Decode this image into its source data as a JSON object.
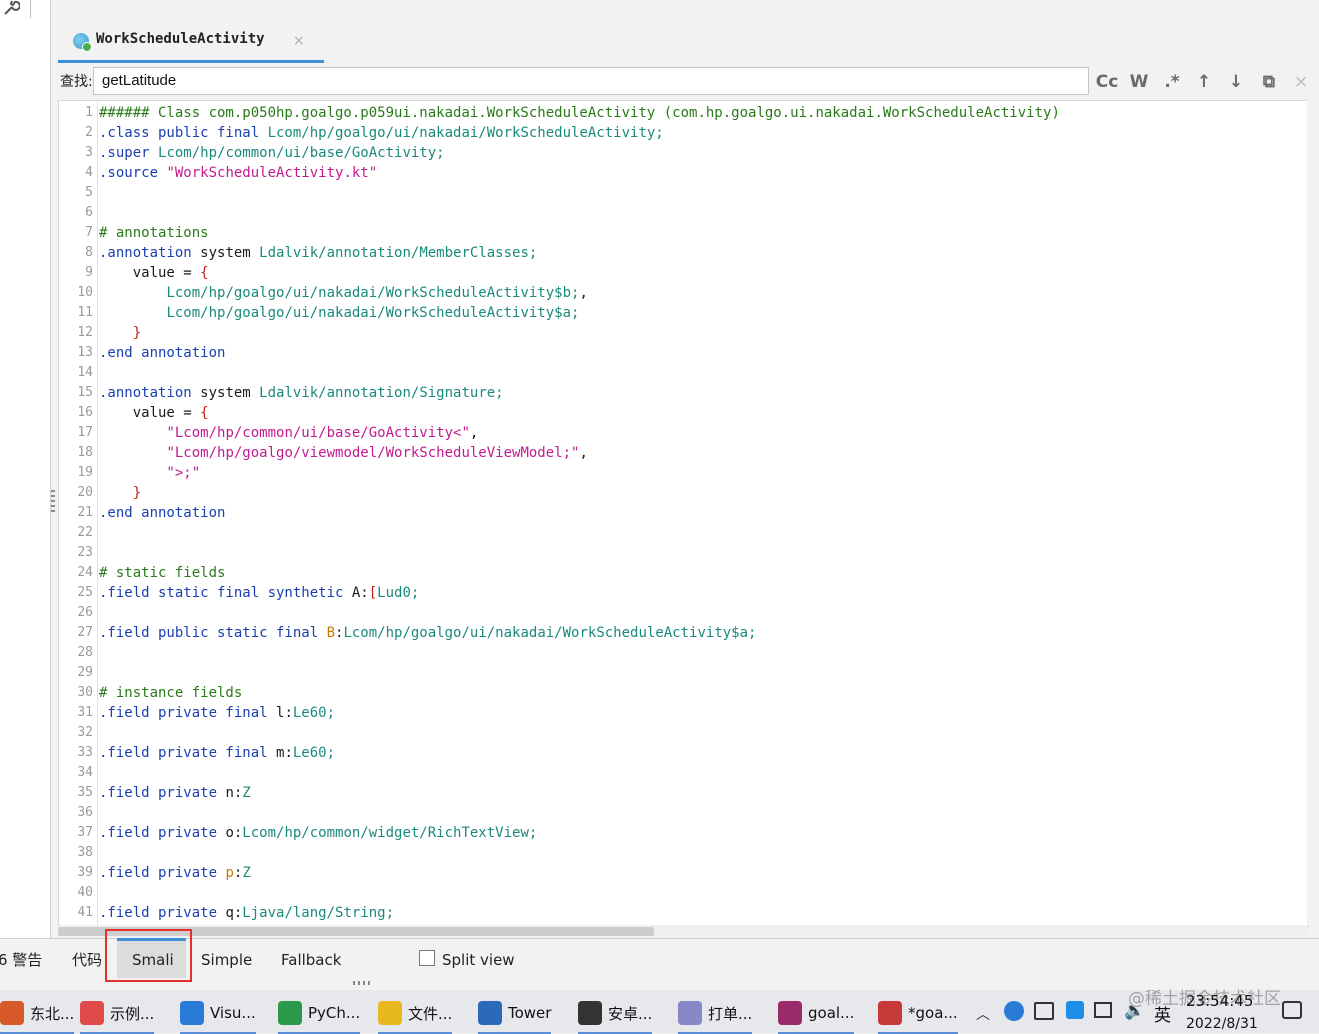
{
  "editor_tab": {
    "title": "WorkScheduleActivity",
    "close": "×"
  },
  "search": {
    "label": "查找:",
    "value": "getLatitude",
    "buttons": {
      "case": "Cc",
      "word": "W",
      "regex": ".*",
      "prev": "↑",
      "next": "↓",
      "find_all": "⧉",
      "close": "×"
    }
  },
  "code_lines": [
    [
      [
        "cm",
        "###### Class com.p050hp.goalgo.p059ui.nakadai.WorkScheduleActivity (com.hp.goalgo.ui.nakadai.WorkScheduleActivity)"
      ]
    ],
    [
      [
        "kw",
        ".class public final "
      ],
      [
        "ty",
        "Lcom/hp/goalgo/ui/nakadai/WorkScheduleActivity;"
      ]
    ],
    [
      [
        "kw",
        ".super "
      ],
      [
        "ty",
        "Lcom/hp/common/ui/base/GoActivity;"
      ]
    ],
    [
      [
        "kw",
        ".source "
      ],
      [
        "st",
        "\"WorkScheduleActivity.kt\""
      ]
    ],
    [],
    [],
    [
      [
        "cm",
        "# annotations"
      ]
    ],
    [
      [
        "kw",
        ".annotation "
      ],
      [
        "tx",
        "system "
      ],
      [
        "ty",
        "Ldalvik/annotation/MemberClasses;"
      ]
    ],
    [
      [
        "tx",
        "    value = "
      ],
      [
        "br",
        "{"
      ]
    ],
    [
      [
        "tx",
        "        "
      ],
      [
        "ty",
        "Lcom/hp/goalgo/ui/nakadai/WorkScheduleActivity$b;"
      ],
      [
        "tx",
        ","
      ]
    ],
    [
      [
        "tx",
        "        "
      ],
      [
        "ty",
        "Lcom/hp/goalgo/ui/nakadai/WorkScheduleActivity$a;"
      ]
    ],
    [
      [
        "tx",
        "    "
      ],
      [
        "br",
        "}"
      ]
    ],
    [
      [
        "kw",
        ".end annotation"
      ]
    ],
    [],
    [
      [
        "kw",
        ".annotation "
      ],
      [
        "tx",
        "system "
      ],
      [
        "ty",
        "Ldalvik/annotation/Signature;"
      ]
    ],
    [
      [
        "tx",
        "    value = "
      ],
      [
        "br",
        "{"
      ]
    ],
    [
      [
        "tx",
        "        "
      ],
      [
        "st",
        "\"Lcom/hp/common/ui/base/GoActivity<\""
      ],
      [
        "tx",
        ","
      ]
    ],
    [
      [
        "tx",
        "        "
      ],
      [
        "st",
        "\"Lcom/hp/goalgo/viewmodel/WorkScheduleViewModel;\""
      ],
      [
        "tx",
        ","
      ]
    ],
    [
      [
        "tx",
        "        "
      ],
      [
        "st",
        "\">;\""
      ]
    ],
    [
      [
        "tx",
        "    "
      ],
      [
        "br",
        "}"
      ]
    ],
    [
      [
        "kw",
        ".end annotation"
      ]
    ],
    [],
    [],
    [
      [
        "cm",
        "# static fields"
      ]
    ],
    [
      [
        "kw",
        ".field static final synthetic "
      ],
      [
        "tx",
        "A:"
      ],
      [
        "br",
        "["
      ],
      [
        "ty",
        "Lud0;"
      ]
    ],
    [],
    [
      [
        "kw",
        ".field public static final "
      ],
      [
        "or",
        "B"
      ],
      [
        "tx",
        ":"
      ],
      [
        "ty",
        "Lcom/hp/goalgo/ui/nakadai/WorkScheduleActivity$a;"
      ]
    ],
    [],
    [],
    [
      [
        "cm",
        "# instance fields"
      ]
    ],
    [
      [
        "kw",
        ".field private final "
      ],
      [
        "tx",
        "l:"
      ],
      [
        "ty",
        "Le60;"
      ]
    ],
    [],
    [
      [
        "kw",
        ".field private final "
      ],
      [
        "tx",
        "m:"
      ],
      [
        "ty",
        "Le60;"
      ]
    ],
    [],
    [
      [
        "kw",
        ".field private "
      ],
      [
        "tx",
        "n:"
      ],
      [
        "ty",
        "Z"
      ]
    ],
    [],
    [
      [
        "kw",
        ".field private "
      ],
      [
        "tx",
        "o:"
      ],
      [
        "ty",
        "Lcom/hp/common/widget/RichTextView;"
      ]
    ],
    [],
    [
      [
        "kw",
        ".field private "
      ],
      [
        "or",
        "p"
      ],
      [
        "tx",
        ":"
      ],
      [
        "ty",
        "Z"
      ]
    ],
    [],
    [
      [
        "kw",
        ".field private "
      ],
      [
        "tx",
        "q:"
      ],
      [
        "ty",
        "Ljava/lang/String;"
      ]
    ]
  ],
  "bottom_tabs": {
    "warnings": "6 警告",
    "code": "代码",
    "smali": "Smali",
    "simple": "Simple",
    "fallback": "Fallback",
    "split_view": "Split view",
    "selected": "Smali"
  },
  "taskbar": {
    "items": [
      {
        "label": "东北...",
        "icon": "app-icon"
      },
      {
        "label": "示例...",
        "icon": "app-icon"
      },
      {
        "label": "Visu...",
        "icon": "vscode-icon"
      },
      {
        "label": "PyCh...",
        "icon": "pycharm-icon"
      },
      {
        "label": "文件...",
        "icon": "folder-icon"
      },
      {
        "label": "Tower",
        "icon": "tower-icon"
      },
      {
        "label": "安卓...",
        "icon": "typora-icon"
      },
      {
        "label": "打单...",
        "icon": "image-icon"
      },
      {
        "label": "goal...",
        "icon": "winrar-icon"
      },
      {
        "label": "*goa...",
        "icon": "jadx-icon"
      }
    ],
    "tray": {
      "ime": "英",
      "time": "23:54:45",
      "date": "2022/8/31"
    },
    "watermark": "@稀土掘金技术社区"
  },
  "colors": {
    "keyword": "#1a3fb0",
    "type": "#1a8a7a",
    "string": "#c21b8f",
    "comment": "#2a7a1a",
    "brace": "#c0201a",
    "highlight": "#e0312a",
    "accent": "#3d8fd8"
  }
}
